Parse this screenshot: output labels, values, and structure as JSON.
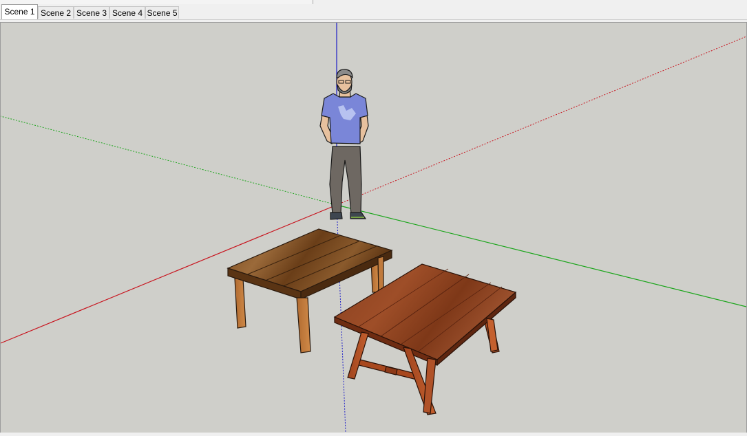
{
  "scene_tabs": [
    {
      "label": "Scene 1",
      "active": true
    },
    {
      "label": "Scene 2",
      "active": false
    },
    {
      "label": "Scene 3",
      "active": false
    },
    {
      "label": "Scene 4",
      "active": false
    },
    {
      "label": "Scene 5",
      "active": false
    }
  ],
  "viewport": {
    "background_color": "#cfcfca",
    "axis_colors": {
      "red": "#c8141e",
      "green": "#19a519",
      "blue": "#1e1ec8"
    },
    "objects": [
      "person-figure",
      "rustic-table",
      "trestle-table"
    ]
  }
}
